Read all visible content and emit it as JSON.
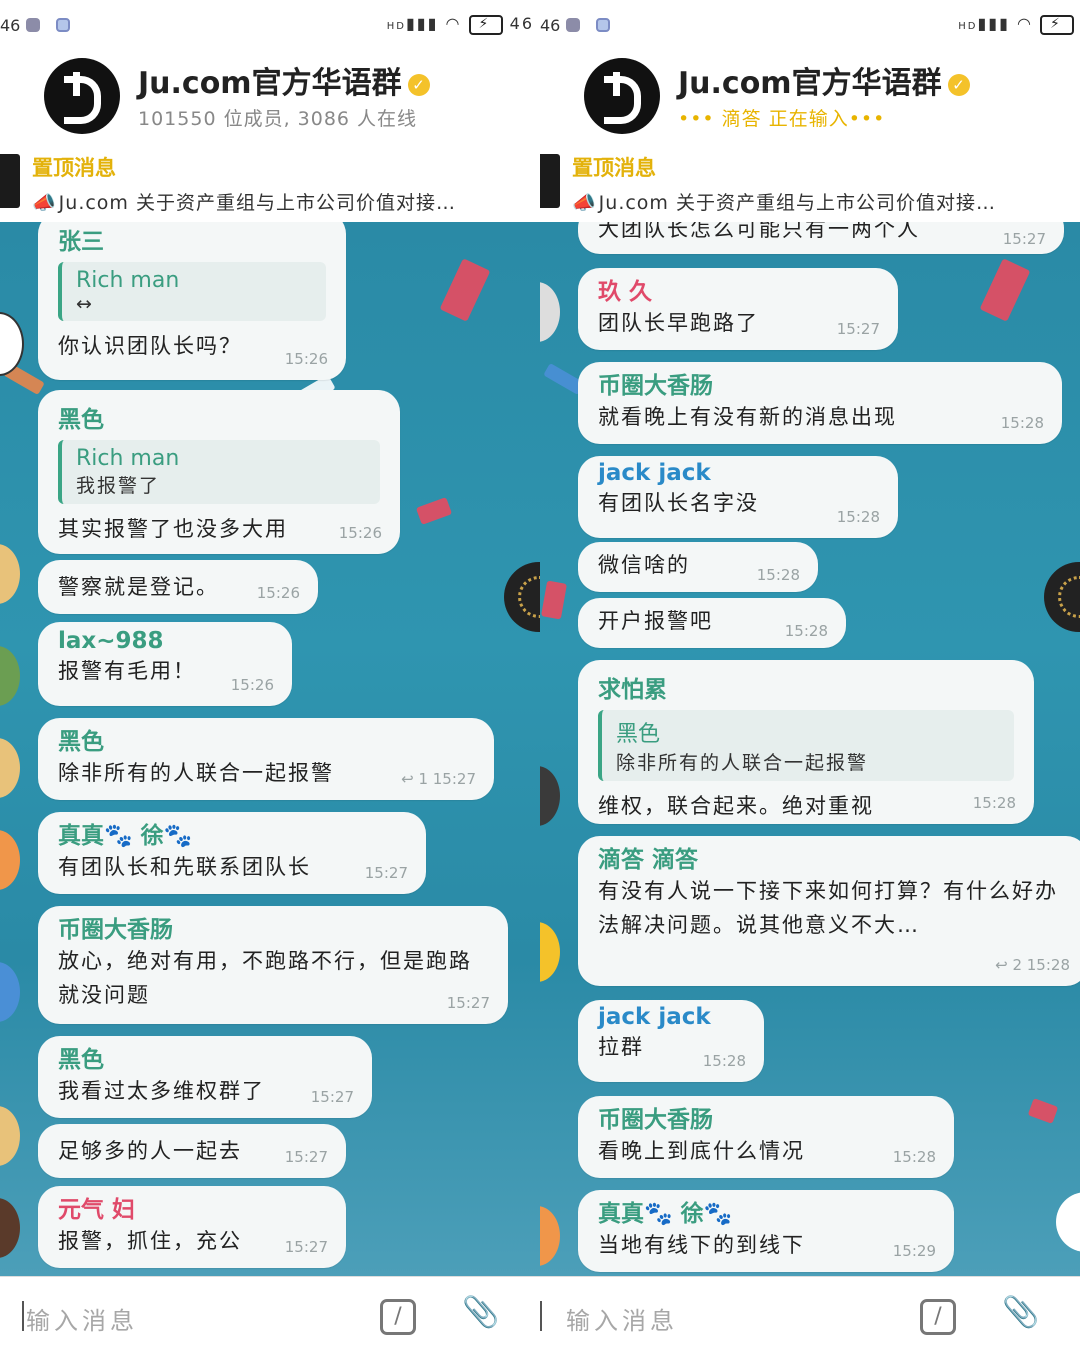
{
  "left": {
    "status": {
      "signal": "46",
      "network": "HD",
      "right_signal": "46"
    },
    "header": {
      "title": "Ju.com官方华语群",
      "subtitle": "101550 位成员, 3086 人在线",
      "verified": "✓"
    },
    "pinned": {
      "label": "置顶消息",
      "text": "Ju.com 关于资产重组与上市公司价值对接…"
    },
    "messages": [
      {
        "sender": "张三",
        "sender_color": "#3a9d80",
        "quote_name": "Rich man",
        "quote_text": "↔",
        "text": "你认识团队长吗？",
        "time": "15:26"
      },
      {
        "sender": "黑色",
        "sender_color": "#3a9d80",
        "quote_name": "Rich man",
        "quote_text": "我报警了",
        "text": "其实报警了也没多大用",
        "time": "15:26"
      },
      {
        "text": "警察就是登记。",
        "time": "15:26"
      },
      {
        "sender": "lax~988",
        "sender_color": "#3a9d80",
        "text": "报警有毛用！",
        "time": "15:26"
      },
      {
        "sender": "黑色",
        "sender_color": "#3a9d80",
        "text": "除非所有的人联合一起报警",
        "time": "15:27",
        "replies": "1"
      },
      {
        "sender": "真真🐾 徐🐾",
        "sender_color": "#3a9d80",
        "text": "有团队长和先联系团队长",
        "time": "15:27"
      },
      {
        "sender": "币圈大香肠",
        "sender_color": "#3a9d80",
        "text": "放心，绝对有用，不跑路不行，但是跑路就没问题",
        "time": "15:27"
      },
      {
        "sender": "黑色",
        "sender_color": "#3a9d80",
        "text": "我看过太多维权群了",
        "time": "15:27"
      },
      {
        "text": "足够多的人一起去",
        "time": "15:27"
      },
      {
        "sender": "元气 妇",
        "sender_color": "#e04a6a",
        "text": "报警，抓住，充公",
        "time": "15:27"
      }
    ],
    "input": {
      "placeholder": "输入消息",
      "command_icon": "/",
      "attach_icon": "📎"
    }
  },
  "right": {
    "status": {
      "signal": "46",
      "network": "HD"
    },
    "header": {
      "title": "Ju.com官方华语群",
      "subtitle": "••• 滴答 正在输入•••",
      "verified": "✓"
    },
    "pinned": {
      "label": "置顶消息",
      "text": "Ju.com 关于资产重组与上市公司价值对接…"
    },
    "messages": [
      {
        "text": "大团队长怎么可能只有一两个人",
        "time": "15:27"
      },
      {
        "sender": "玖 久",
        "sender_color": "#e04a6a",
        "text": "团队长早跑路了",
        "time": "15:27"
      },
      {
        "sender": "币圈大香肠",
        "sender_color": "#3a9d80",
        "text": "就看晚上有没有新的消息出现",
        "time": "15:28"
      },
      {
        "sender": "jack jack",
        "sender_color": "#2a8ac8",
        "text": "有团队长名字没",
        "time": "15:28"
      },
      {
        "text": "微信啥的",
        "time": "15:28"
      },
      {
        "text": "开户报警吧",
        "time": "15:28"
      },
      {
        "sender": "求怕累",
        "sender_color": "#3a9d80",
        "quote_name": "黑色",
        "quote_text": "除非所有的人联合一起报警",
        "text": "维权，联合起来。绝对重视",
        "time": "15:28"
      },
      {
        "sender": "滴答 滴答",
        "sender_color": "#3a9d80",
        "text": "有没有人说一下接下来如何打算？有什么好办法解决问题。说其他意义不大…",
        "time": "15:28",
        "replies": "2"
      },
      {
        "sender": "jack jack",
        "sender_color": "#2a8ac8",
        "text": "拉群",
        "time": "15:28"
      },
      {
        "sender": "币圈大香肠",
        "sender_color": "#3a9d80",
        "text": "看晚上到底什么情况",
        "time": "15:28"
      },
      {
        "sender": "真真🐾 徐🐾",
        "sender_color": "#3a9d80",
        "text": "当地有线下的到线下",
        "time": "15:29"
      }
    ],
    "input": {
      "placeholder": "输入消息",
      "command_icon": "/",
      "attach_icon": "📎"
    }
  },
  "colors": {
    "chat_bg": "#2a8aa6",
    "accent": "#e3b20a",
    "bubble": "#f4f7f7",
    "sender_green": "#3a9d80",
    "sender_red": "#e04a6a",
    "sender_blue": "#2a8ac8"
  }
}
